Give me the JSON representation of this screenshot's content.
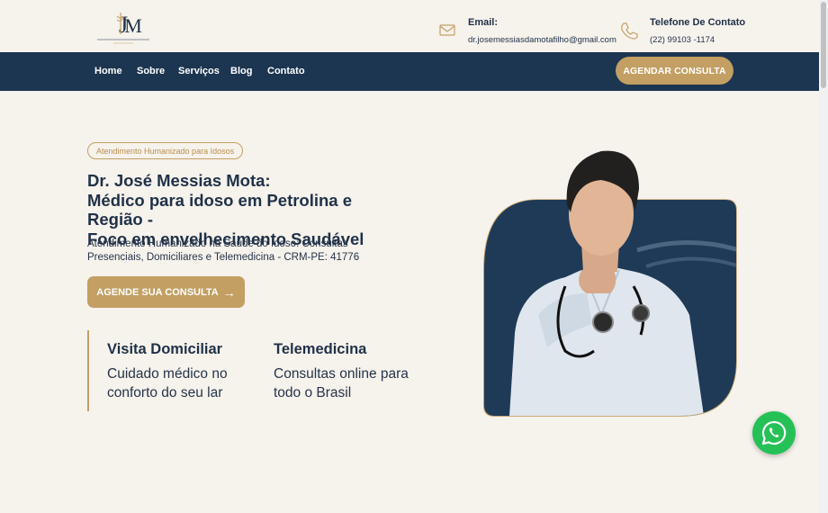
{
  "brand": {
    "logo_monogram": "J M",
    "logo_tagline": "JOSÉ MESSIAS DA MOTA FILHO · MÉDICO"
  },
  "contact": {
    "email": {
      "label": "Email:",
      "value": "dr.josemessiasdamotafilho@gmail.com",
      "icon": "mail-icon"
    },
    "phone": {
      "label": "Telefone De Contato",
      "value": "(22) 99103 -1174",
      "icon": "phone-icon"
    }
  },
  "nav": {
    "items": [
      "Home",
      "Sobre",
      "Serviços",
      "Blog",
      "Contato"
    ],
    "cta": "AGENDAR CONSULTA"
  },
  "hero": {
    "pill": "Atendimento Humanizado para Idosos",
    "headline": [
      "Dr. José Messias Mota:",
      "Médico para idoso em Petrolina e Região -",
      "Foco em envelhecimento Saudável"
    ],
    "subtext": "Atendimento Humanizado na Saúde do Idoso: Consultas Presenciais, Domiciliares e Telemedicina - CRM-PE: 41776",
    "cta": "AGENDE SUA CONSULTA"
  },
  "features": [
    {
      "title": "Visita Domiciliar",
      "description": "Cuidado médico no conforto do seu lar"
    },
    {
      "title": "Telemedicina",
      "description": "Consultas online para todo o Brasil"
    }
  ],
  "colors": {
    "navy": "#1c3550",
    "gold": "#c39f63",
    "background": "#f6f2ec",
    "whatsapp": "#25c157"
  }
}
